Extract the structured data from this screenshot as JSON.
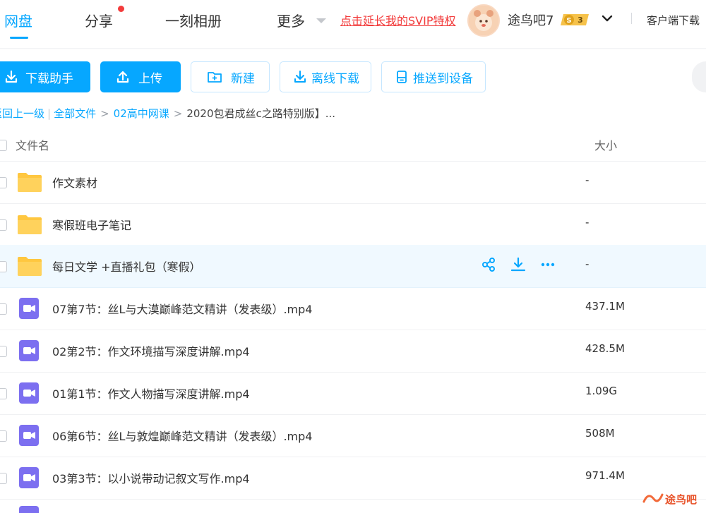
{
  "nav": {
    "tabs": [
      {
        "label": "网盘",
        "active": true
      },
      {
        "label": "分享"
      },
      {
        "label": "一刻相册"
      },
      {
        "label": "更多"
      }
    ],
    "svip_link": "点击延长我的SVIP特权",
    "username": "途鸟吧7",
    "level_badge": "S 3",
    "client_download": "客户端下载"
  },
  "toolbar": {
    "download_helper": "下载助手",
    "upload": "上传",
    "new": "新建",
    "offline_download": "离线下载",
    "push_device": "推送到设备"
  },
  "breadcrumb": {
    "back": "返回上一级",
    "items": [
      "全部文件",
      "02高中网课"
    ],
    "current": "2020包君成丝c之路特别版】..."
  },
  "table": {
    "col_name": "文件名",
    "col_size": "大小",
    "rows": [
      {
        "name": "作文素材",
        "size": "-",
        "type": "folder"
      },
      {
        "name": "寒假班电子笔记",
        "size": "-",
        "type": "folder"
      },
      {
        "name": "每日文学 +直播礼包（寒假）",
        "size": "-",
        "type": "folder",
        "hover": true
      },
      {
        "name": "07第7节：丝L与大漠巅峰范文精讲（发表级）.mp4",
        "size": "437.1M",
        "type": "video"
      },
      {
        "name": "02第2节：作文环境描写深度讲解.mp4",
        "size": "428.5M",
        "type": "video"
      },
      {
        "name": "01第1节：作文人物描写深度讲解.mp4",
        "size": "1.09G",
        "type": "video"
      },
      {
        "name": "06第6节：丝L与敦煌巅峰范文精讲（发表级）.mp4",
        "size": "508M",
        "type": "video"
      },
      {
        "name": "03第3节：以小说带动记叙文写作.mp4",
        "size": "971.4M",
        "type": "video"
      }
    ]
  },
  "colors": {
    "accent": "#06a7ff",
    "svip_red": "#f23b3b",
    "folder": "#ffc740",
    "video": "#7c6ff0"
  },
  "icons": {
    "download": "download-icon",
    "upload": "upload-icon",
    "new_folder": "new-folder-icon",
    "offline": "offline-download-icon",
    "device": "device-icon",
    "share": "share-icon",
    "more": "more-icon"
  },
  "watermark": "途鸟吧"
}
